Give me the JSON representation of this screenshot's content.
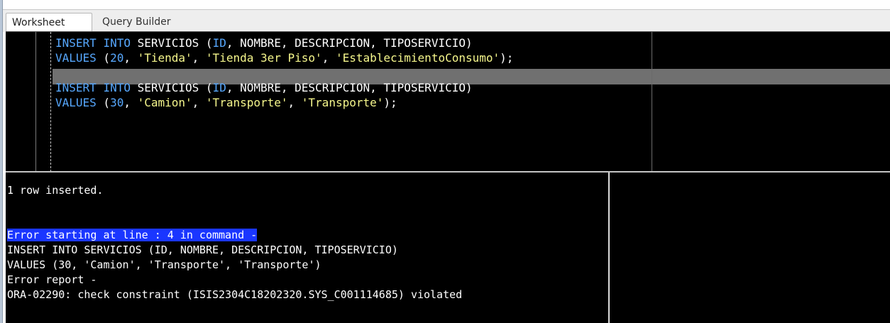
{
  "tabs": [
    {
      "label": "Worksheet",
      "active": true
    },
    {
      "label": "Query Builder",
      "active": false
    }
  ],
  "editor": {
    "lines": [
      [
        {
          "t": "INSERT",
          "k": "kw"
        },
        {
          "t": " ",
          "k": "plain"
        },
        {
          "t": "INTO",
          "k": "kw"
        },
        {
          "t": " SERVICIOS (",
          "k": "plain"
        },
        {
          "t": "ID",
          "k": "kw"
        },
        {
          "t": ", NOMBRE, DESCRIPCION, TIPOSERVICIO)",
          "k": "plain"
        }
      ],
      [
        {
          "t": "VALUES",
          "k": "kw"
        },
        {
          "t": " (",
          "k": "plain"
        },
        {
          "t": "20",
          "k": "num"
        },
        {
          "t": ", ",
          "k": "plain"
        },
        {
          "t": "'Tienda'",
          "k": "str"
        },
        {
          "t": ", ",
          "k": "plain"
        },
        {
          "t": "'Tienda 3er Piso'",
          "k": "str"
        },
        {
          "t": ", ",
          "k": "plain"
        },
        {
          "t": "'EstablecimientoConsumo'",
          "k": "str"
        },
        {
          "t": ");",
          "k": "plain"
        }
      ],
      [],
      [
        {
          "t": "INSERT",
          "k": "kw"
        },
        {
          "t": " ",
          "k": "plain"
        },
        {
          "t": "INTO",
          "k": "kw"
        },
        {
          "t": " SERVICIOS (",
          "k": "plain"
        },
        {
          "t": "ID",
          "k": "kw"
        },
        {
          "t": ", NOMBRE, DESCRIPCION, TIPOSERVICIO)",
          "k": "plain"
        }
      ],
      [
        {
          "t": "VALUES",
          "k": "kw"
        },
        {
          "t": " (",
          "k": "plain"
        },
        {
          "t": "30",
          "k": "num"
        },
        {
          "t": ", ",
          "k": "plain"
        },
        {
          "t": "'Camion'",
          "k": "str"
        },
        {
          "t": ", ",
          "k": "plain"
        },
        {
          "t": "'Transporte'",
          "k": "str"
        },
        {
          "t": ", ",
          "k": "plain"
        },
        {
          "t": "'Transporte'",
          "k": "str"
        },
        {
          "t": ");",
          "k": "plain"
        }
      ]
    ]
  },
  "output": {
    "lines": [
      {
        "text": "1 row inserted.",
        "style": "normal"
      },
      {
        "text": "",
        "style": "normal"
      },
      {
        "text": "",
        "style": "normal"
      },
      {
        "text": "Error starting at line : 4 in command -",
        "style": "selected"
      },
      {
        "text": "INSERT INTO SERVICIOS (ID, NOMBRE, DESCRIPCION, TIPOSERVICIO)",
        "style": "normal"
      },
      {
        "text": "VALUES (30, 'Camion', 'Transporte', 'Transporte')",
        "style": "normal"
      },
      {
        "text": "Error report -",
        "style": "normal"
      },
      {
        "text": "ORA-02290: check constraint (ISIS2304C18202320.SYS_C001114685) violated",
        "style": "normal"
      }
    ]
  },
  "colors": {
    "keyword": "#57a8ff",
    "string": "#f6f78c",
    "editor_bg": "#000000",
    "selection": "#1a36ff"
  }
}
